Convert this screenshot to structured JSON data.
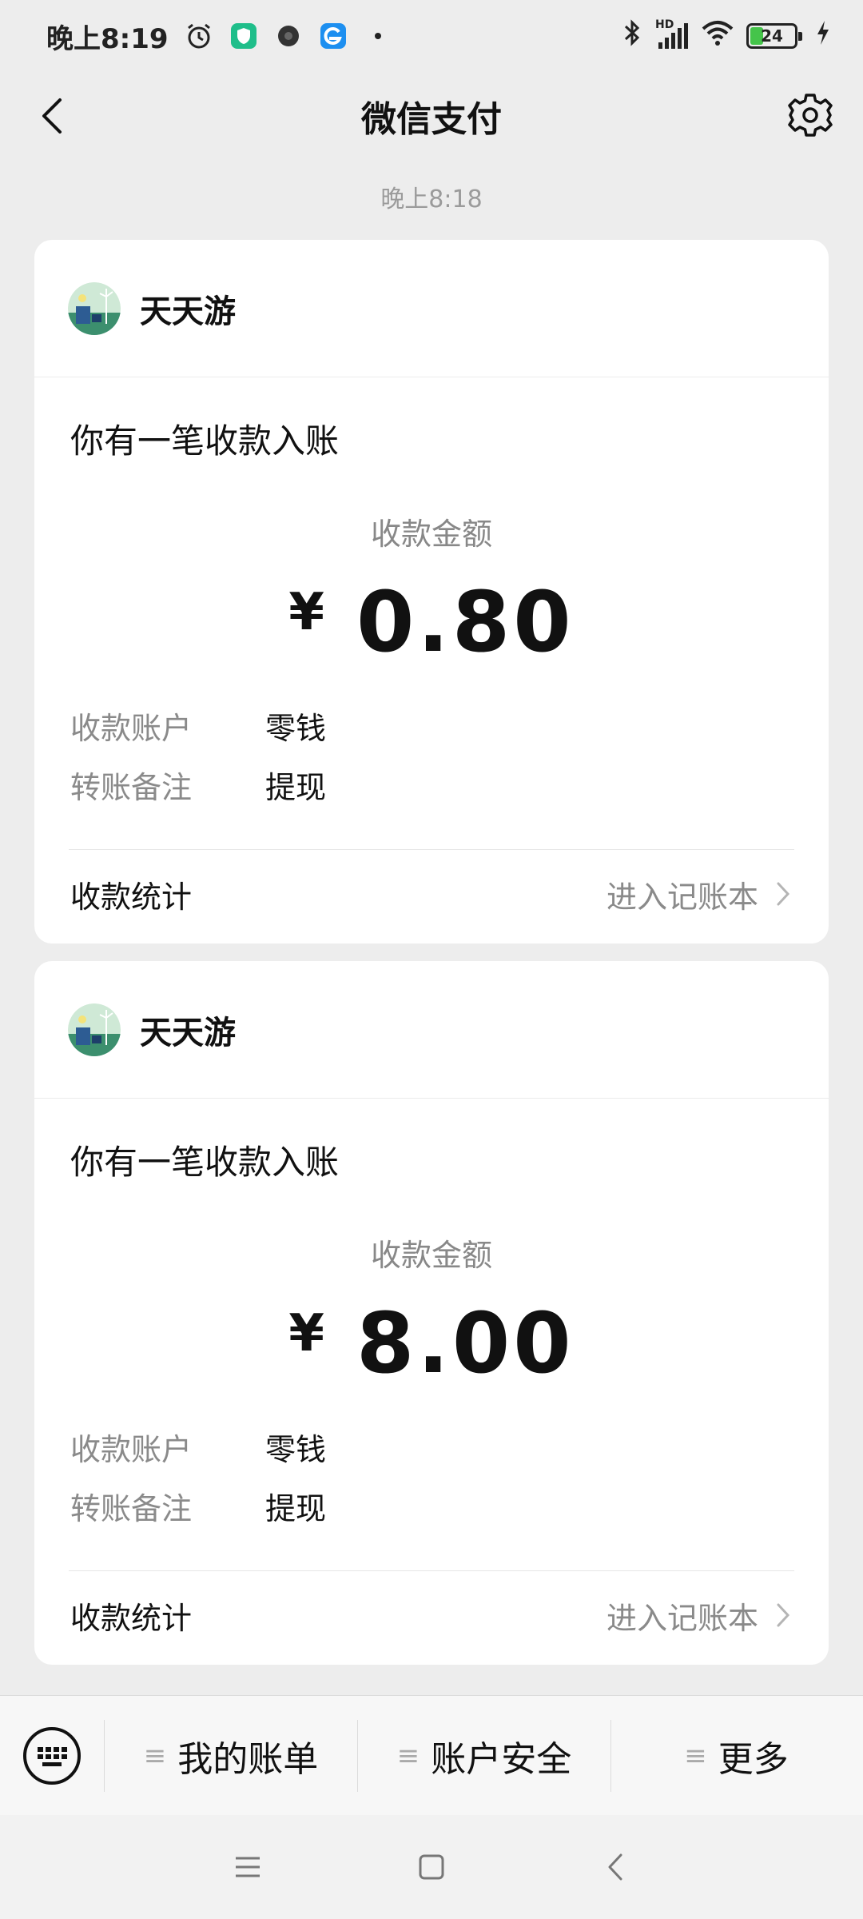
{
  "status_bar": {
    "time": "晚上8:19",
    "network": "HD",
    "battery": "24"
  },
  "nav": {
    "title": "微信支付"
  },
  "timestamp": "晚上8:18",
  "cards": [
    {
      "sender": "天天游",
      "notice": "你有一笔收款入账",
      "amount_label": "收款金额",
      "currency": "¥",
      "amount": "0.80",
      "rows": [
        {
          "key": "收款账户",
          "value": "零钱"
        },
        {
          "key": "转账备注",
          "value": "提现"
        }
      ],
      "footer_left": "收款统计",
      "footer_right": "进入记账本"
    },
    {
      "sender": "天天游",
      "notice": "你有一笔收款入账",
      "amount_label": "收款金额",
      "currency": "¥",
      "amount": "8.00",
      "rows": [
        {
          "key": "收款账户",
          "value": "零钱"
        },
        {
          "key": "转账备注",
          "value": "提现"
        }
      ],
      "footer_left": "收款统计",
      "footer_right": "进入记账本"
    }
  ],
  "menu": {
    "items": [
      "我的账单",
      "账户安全",
      "更多"
    ],
    "hamburger": "≡"
  },
  "colors": {
    "page_bg": "#ededed",
    "card_bg": "#ffffff",
    "secondary_text": "#8a8a8a",
    "battery_green": "#45c44a"
  }
}
